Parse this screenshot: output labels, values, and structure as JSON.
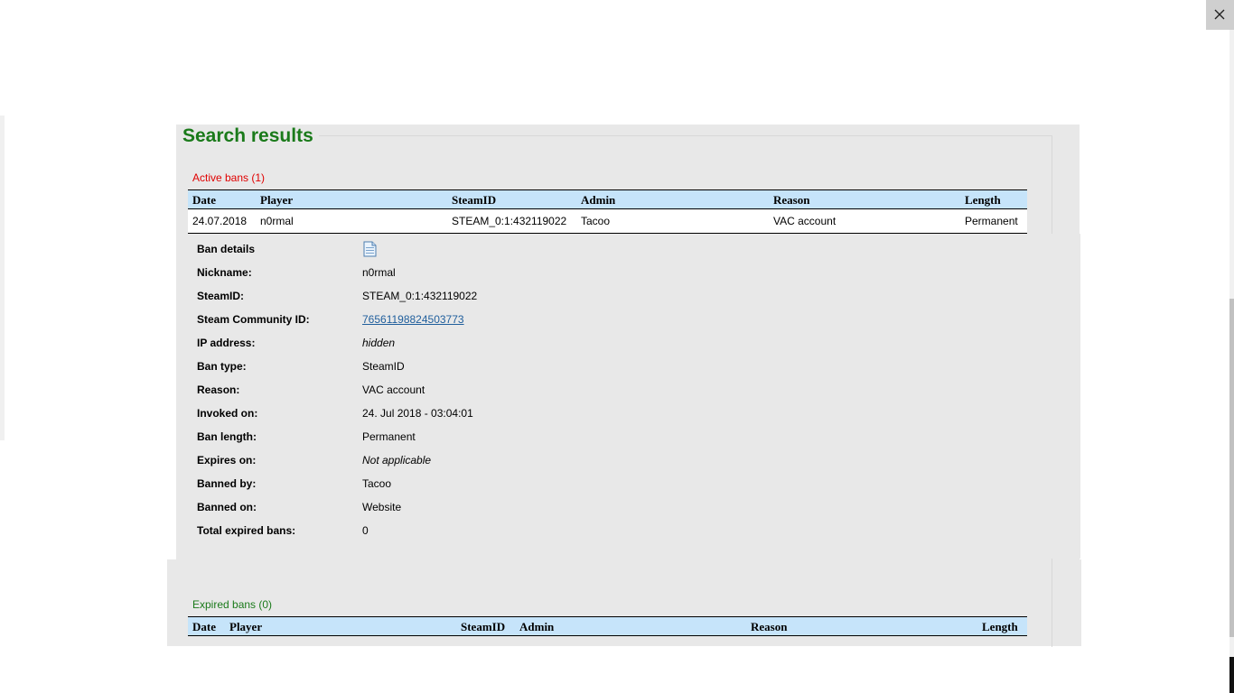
{
  "page": {
    "title": "Search results",
    "close_icon": "close-icon"
  },
  "active_bans": {
    "label": "Active bans (1)",
    "columns": [
      "Date",
      "Player",
      "SteamID",
      "Admin",
      "Reason",
      "Length"
    ],
    "rows": [
      {
        "date": "24.07.2018",
        "player": "n0rmal",
        "steamid": "STEAM_0:1:432119022",
        "admin": "Tacoo",
        "reason": "VAC account",
        "length": "Permanent"
      }
    ]
  },
  "ban_details": {
    "heading": "Ban details",
    "heading_icon": "document-icon",
    "fields": [
      {
        "label": "Nickname:",
        "value": "n0rmal"
      },
      {
        "label": "SteamID:",
        "value": "STEAM_0:1:432119022"
      },
      {
        "label": "Steam Community ID:",
        "value": "76561198824503773"
      },
      {
        "label": "IP address:",
        "value": "hidden"
      },
      {
        "label": "Ban type:",
        "value": "SteamID"
      },
      {
        "label": "Reason:",
        "value": "VAC account"
      },
      {
        "label": "Invoked on:",
        "value": "24. Jul 2018 - 03:04:01"
      },
      {
        "label": "Ban length:",
        "value": "Permanent"
      },
      {
        "label": "Expires on:",
        "value": "Not applicable"
      },
      {
        "label": "Banned by:",
        "value": "Tacoo"
      },
      {
        "label": "Banned on:",
        "value": "Website"
      },
      {
        "label": "Total expired bans:",
        "value": "0"
      }
    ]
  },
  "expired_bans": {
    "label": "Expired bans (0)",
    "columns": [
      "Date",
      "Player",
      "SteamID",
      "Admin",
      "Reason",
      "Length"
    ]
  },
  "colors": {
    "title_green": "#1a7a1a",
    "active_red": "#e00000",
    "header_blue": "#c6e4fa",
    "panel_gray": "#e8e8e8",
    "link_blue": "#1f5e9c"
  }
}
